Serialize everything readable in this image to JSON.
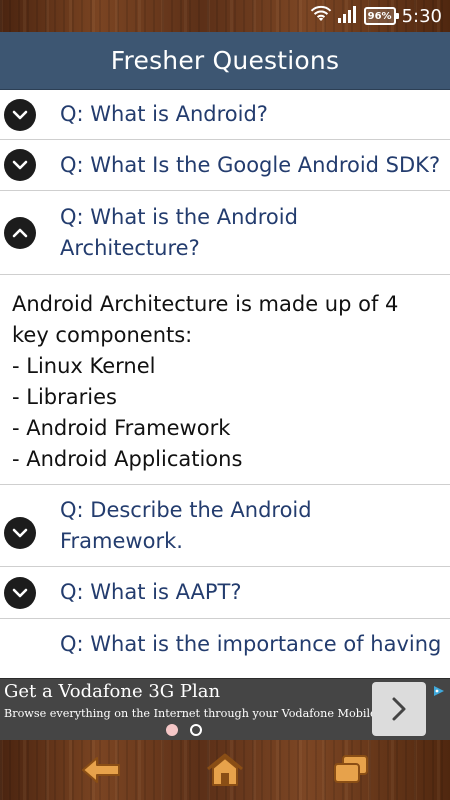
{
  "status_bar": {
    "battery": "96%",
    "time": "5:30",
    "icons": [
      "wifi-icon",
      "signal-icon",
      "battery-icon"
    ]
  },
  "header": {
    "title": "Fresher Questions"
  },
  "questions": [
    {
      "text": "Q:  What is Android?",
      "expanded": false
    },
    {
      "text": "Q: What Is the Google Android SDK?",
      "expanded": false
    },
    {
      "text": "Q: What is the Android Architecture?",
      "expanded": true,
      "answer": [
        "Android Architecture is made up of 4 key components:",
        "- Linux Kernel",
        "- Libraries",
        "- Android Framework",
        "- Android Applications"
      ]
    },
    {
      "text": "Q: Describe the Android Framework.",
      "expanded": false
    },
    {
      "text": "Q: What is AAPT?",
      "expanded": false
    },
    {
      "text": "Q: What is the importance of having",
      "expanded": false
    }
  ],
  "ad": {
    "title": "Get a Vodafone 3G Plan",
    "description": "Browse everything on the Internet through your Vodafone Mobile Phone.",
    "pager_total": 2,
    "pager_active": 1
  },
  "bottom_nav": {
    "icons": [
      "back-arrow-icon",
      "home-icon",
      "recent-apps-icon"
    ]
  },
  "colors": {
    "header_bg": "#3d5672",
    "question_text": "#233c6e",
    "ad_bg": "#454545"
  }
}
